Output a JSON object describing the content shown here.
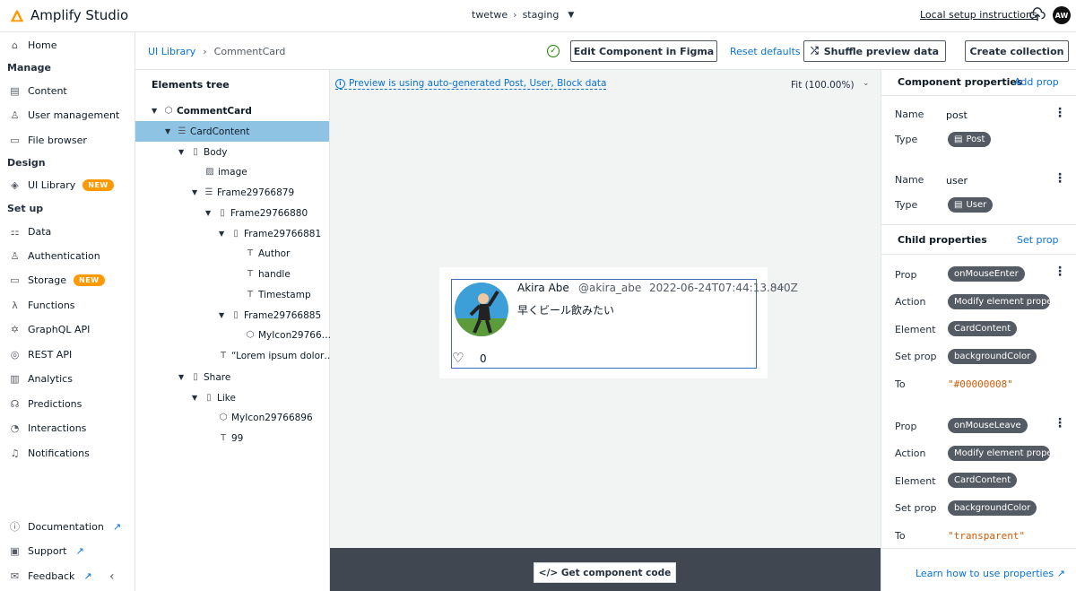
{
  "app": {
    "title": "Amplify Studio",
    "app_name": "twetwe",
    "env_name": "staging",
    "local_setup": "Local setup instructions",
    "avatar": "AW"
  },
  "sidebar": {
    "home": "Home",
    "sections": {
      "manage": "Manage",
      "design": "Design",
      "setup": "Set up"
    },
    "content": "Content",
    "user_management": "User management",
    "file_browser": "File browser",
    "ui_library": "UI Library",
    "new_badge": "NEW",
    "data": "Data",
    "authentication": "Authentication",
    "storage": "Storage",
    "functions": "Functions",
    "graphql": "GraphQL API",
    "rest": "REST API",
    "analytics": "Analytics",
    "predictions": "Predictions",
    "interactions": "Interactions",
    "notifications": "Notifications",
    "documentation": "Documentation",
    "support": "Support",
    "feedback": "Feedback"
  },
  "breadcrumb": {
    "root": "UI Library",
    "current": "CommentCard"
  },
  "toolbar": {
    "edit_figma": "Edit Component in Figma",
    "reset": "Reset defaults",
    "shuffle": "Shuffle preview data",
    "create_collection": "Create collection"
  },
  "tree": {
    "title": "Elements tree",
    "nodes": [
      "CommentCard",
      "CardContent",
      "Body",
      "image",
      "Frame29766879",
      "Frame29766880",
      "Frame29766881",
      "Author",
      "handle",
      "Timestamp",
      "Frame29766885",
      "MyIcon29766…",
      "“Lorem ipsum dolor…",
      "Share",
      "Like",
      "MyIcon29766896",
      "99"
    ]
  },
  "canvas": {
    "notice": "Preview is using auto-generated Post, User, Block data",
    "fit": "Fit (100.00%)",
    "get_code": "</> Get component code"
  },
  "preview": {
    "author": "Akira Abe",
    "handle": "@akira_abe",
    "timestamp": "2022-06-24T07:44:13.840Z",
    "message": "早くビール飲みたい",
    "likes": "0"
  },
  "props": {
    "component_title": "Component properties",
    "add_prop": "Add prop",
    "name_label": "Name",
    "type_label": "Type",
    "component": [
      {
        "name": "post",
        "type": "Post"
      },
      {
        "name": "user",
        "type": "User"
      }
    ],
    "child_title": "Child properties",
    "set_prop": "Set prop",
    "labels": {
      "prop": "Prop",
      "action": "Action",
      "element": "Element",
      "set_prop": "Set prop",
      "to": "To"
    },
    "child": [
      {
        "prop": "onMouseEnter",
        "action": "Modify element prope",
        "element": "CardContent",
        "set_prop": "backgroundColor",
        "to": "\"#00000008\""
      },
      {
        "prop": "onMouseLeave",
        "action": "Modify element prope",
        "element": "CardContent",
        "set_prop": "backgroundColor",
        "to": "\"transparent\""
      }
    ],
    "learn": "Learn how to use properties"
  }
}
